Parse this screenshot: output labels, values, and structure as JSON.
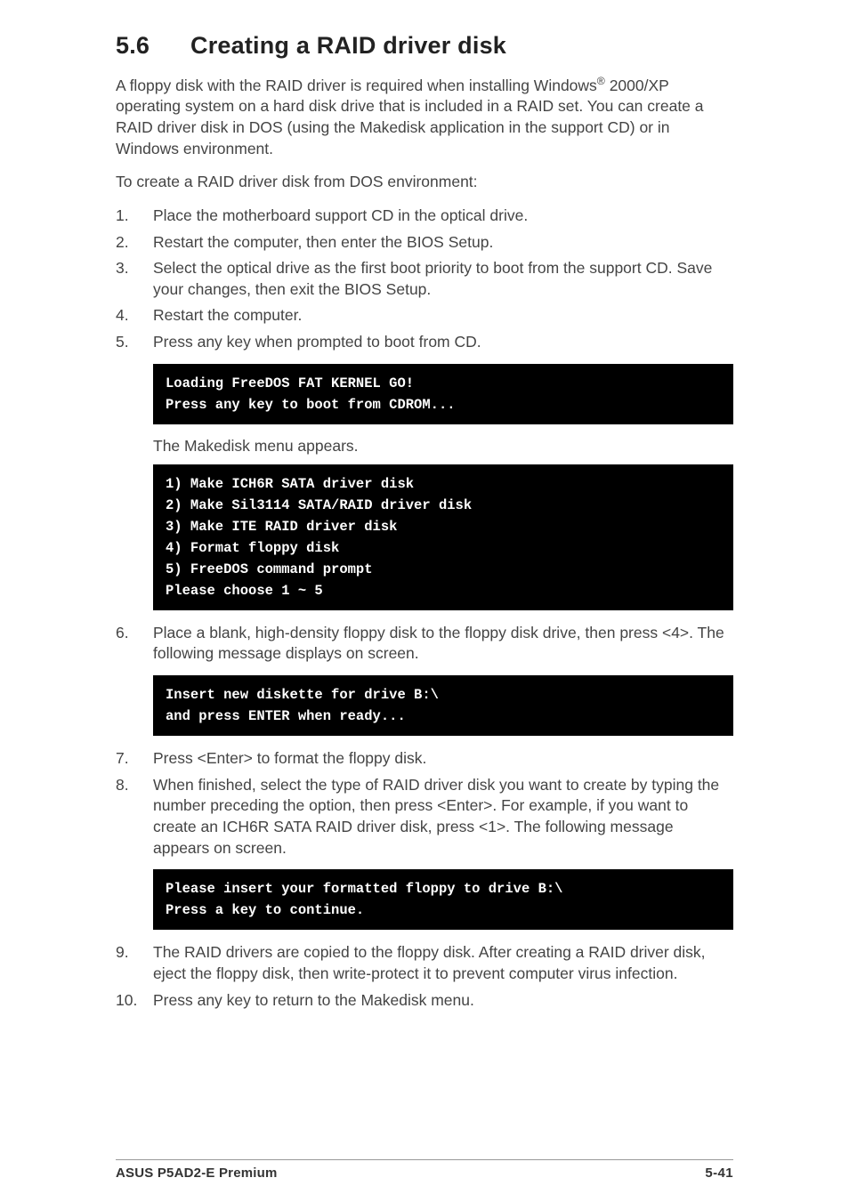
{
  "heading": {
    "number": "5.6",
    "title": "Creating a RAID driver disk"
  },
  "intro_html": "A floppy disk with the RAID driver is required when installing Windows<sup>®</sup> 2000/XP operating system on a hard disk drive that is included in a RAID set. You can create a RAID driver disk in DOS (using the Makedisk application in the support CD) or in Windows environment.",
  "lead": "To create a RAID driver disk from DOS environment:",
  "steps_a": [
    {
      "n": "1.",
      "t": "Place the motherboard support CD in the optical drive."
    },
    {
      "n": "2.",
      "t": "Restart the computer, then enter the BIOS Setup."
    },
    {
      "n": "3.",
      "t": "Select the optical drive as the first boot priority to boot from the support CD. Save your changes, then exit the BIOS Setup."
    },
    {
      "n": "4.",
      "t": "Restart the computer."
    },
    {
      "n": "5.",
      "t": "Press any key when prompted to boot from CD."
    }
  ],
  "code1": "Loading FreeDOS FAT KERNEL GO!\nPress any key to boot from CDROM...",
  "caption1": "The Makedisk menu appears.",
  "code2": "1) Make ICH6R SATA driver disk\n2) Make Sil3114 SATA/RAID driver disk\n3) Make ITE RAID driver disk\n4) Format floppy disk\n5) FreeDOS command prompt\nPlease choose 1 ~ 5",
  "steps_b": [
    {
      "n": "6.",
      "t": "Place a blank, high-density floppy disk to the floppy disk drive, then press <4>. The following message displays on screen."
    }
  ],
  "code3": "Insert new diskette for drive B:\\\nand press ENTER when ready...",
  "steps_c": [
    {
      "n": "7.",
      "t": "Press <Enter> to format the floppy disk."
    },
    {
      "n": "8.",
      "t": "When finished, select the type of RAID driver disk you want to create by typing the number preceding the option, then press <Enter>. For example, if you want to create an ICH6R SATA RAID driver disk, press <1>. The following message appears on screen."
    }
  ],
  "code4": "Please insert your formatted floppy to drive B:\\\nPress a key to continue.",
  "steps_d": [
    {
      "n": "9.",
      "t": "The RAID drivers are copied to the floppy disk. After creating a RAID driver disk, eject the floppy disk, then write-protect it to prevent computer virus infection."
    },
    {
      "n": "10.",
      "t": "Press any key to return to the Makedisk menu."
    }
  ],
  "footer": {
    "left": "ASUS P5AD2-E Premium",
    "right": "5-41"
  }
}
